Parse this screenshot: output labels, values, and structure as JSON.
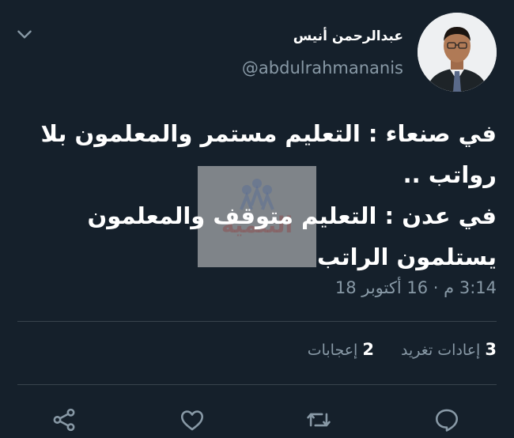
{
  "author": {
    "display_name": "عبدالرحمن أنيس",
    "handle": "@abdulrahmananis"
  },
  "tweet": {
    "lines": [
      "في صنعاء : التعليم مستمر والمعلمون بلا",
      "رواتب ..",
      "في عدن : التعليم متوقف والمعلمون",
      "يستلمون الراتب"
    ],
    "timestamp": "3:14 م · 16 أكتوبر 18"
  },
  "watermark": {
    "brand": "التنمية"
  },
  "stats": {
    "retweets_count": "3",
    "retweets_label": "إعادات تغريد",
    "likes_count": "2",
    "likes_label": "إعجابات"
  },
  "icons": {
    "menu": "chevron-down-icon",
    "reply": "reply-icon",
    "retweet": "retweet-icon",
    "like": "heart-icon",
    "share": "share-icon"
  },
  "colors": {
    "background": "#15202b",
    "secondary_text": "#8899a6",
    "divider": "#38444d"
  }
}
